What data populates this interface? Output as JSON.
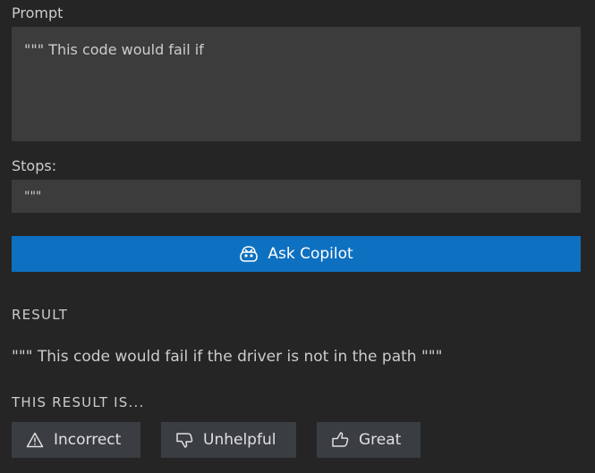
{
  "prompt": {
    "label": "Prompt",
    "value": "\"\"\" This code would fail if"
  },
  "stops": {
    "label": "Stops:",
    "value": "\"\"\""
  },
  "ask_button": {
    "label": "Ask Copilot",
    "icon": "copilot-icon"
  },
  "result": {
    "heading": "RESULT",
    "text": "\"\"\" This code would fail if the driver is not in the path \"\"\""
  },
  "rating": {
    "heading": "THIS RESULT IS...",
    "buttons": [
      {
        "label": "Incorrect",
        "icon": "warning-icon"
      },
      {
        "label": "Unhelpful",
        "icon": "thumbs-down-icon"
      },
      {
        "label": "Great",
        "icon": "thumbs-up-icon"
      }
    ]
  },
  "colors": {
    "background": "#252526",
    "input_background": "#3c3c3c",
    "primary_button": "#0e70c0",
    "secondary_button": "#3a3d41",
    "text": "#cccccc"
  }
}
